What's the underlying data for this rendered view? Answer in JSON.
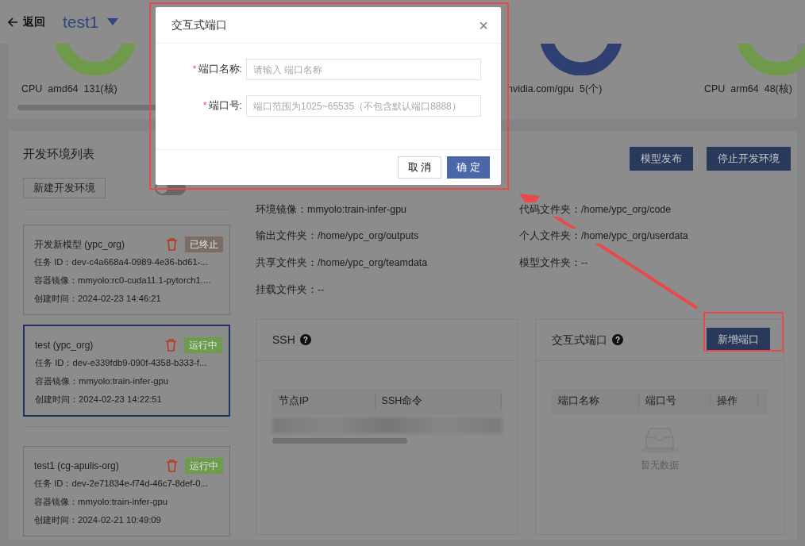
{
  "header": {
    "back": "返回",
    "title": "test1"
  },
  "resources": [
    {
      "label": "CPU  amd64  131(核)",
      "color": "#6f9a4c"
    },
    {
      "label": "nvidia.com/gpu  5(个)",
      "color": "#2f3f72"
    },
    {
      "label": "CPU  arm64  48(核)",
      "color": "#6f9a4c"
    }
  ],
  "env_list": {
    "title": "开发环境列表",
    "new_button": "新建开发环境",
    "only_mine_switch": {
      "on": false
    },
    "items": [
      {
        "name": "开发新模型 (ypc_org)",
        "status": "已终止",
        "color": "#7b6d63",
        "task_id": "任务 ID：dev-c4a668a4-0989-4e36-bd61-...",
        "image": "容器镜像：mmyolo:rc0-cuda11.1-pytorch1....",
        "created": "创建时间：2024-02-23 14:46:21",
        "selected": false
      },
      {
        "name": "test (ypc_org)",
        "status": "运行中",
        "color": "#6e9c4e",
        "task_id": "任务 ID：dev-e339fdb9-090f-4358-b333-f...",
        "image": "容器镜像：mmyolo:train-infer-gpu",
        "created": "创建时间：2024-02-23 14:22:51",
        "selected": true
      },
      {
        "name": "test1 (cg-apulis-org)",
        "status": "运行中",
        "color": "#6e9c4e",
        "task_id": "任务 ID：dev-2e71834e-f74d-46c7-8def-0...",
        "image": "容器镜像：mmyolo:train-infer-gpu",
        "created": "创建时间：2024-02-21 10:49:09",
        "selected": false
      }
    ]
  },
  "actions": [
    "模型发布",
    "停止开发环境"
  ],
  "details": [
    "环境镜像：mmyolo:train-infer-gpu",
    "代码文件夹：/home/ypc_org/code",
    "输出文件夹：/home/ypc_org/outputs",
    "个人文件夹：/home/ypc_org/userdata",
    "共享文件夹：/home/ypc_org/teamdata",
    "模型文件夹：--",
    "挂载文件夹：--"
  ],
  "ssh_card": {
    "title": "SSH",
    "help": "?",
    "columns": [
      "节点IP",
      "SSH命令"
    ]
  },
  "port_card": {
    "title": "交互式端口",
    "help": "?",
    "add_button": "新增端口",
    "columns": [
      "端口名称",
      "端口号",
      "操作"
    ],
    "empty": "暂无数据"
  },
  "modal": {
    "title": "交互式端口",
    "close": "×",
    "fields": [
      {
        "mark": "*",
        "label": "端口名称:",
        "placeholder": "请输入 端口名称"
      },
      {
        "mark": "*",
        "label": "端口号:",
        "placeholder": "端口范围为1025~65535（不包含默认端口8888）"
      }
    ],
    "cancel": "取 消",
    "ok": "确 定"
  }
}
